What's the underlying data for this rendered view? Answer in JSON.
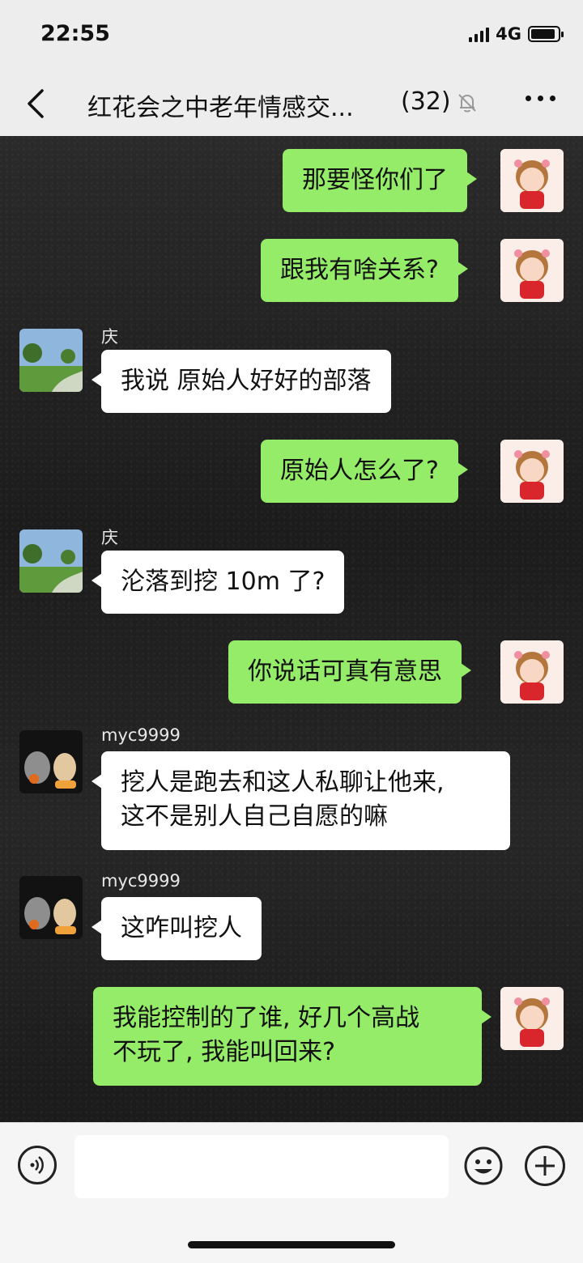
{
  "status_bar": {
    "time": "22:55",
    "network": "4G"
  },
  "header": {
    "title": "红花会之中老年情感交...",
    "member_count": "(32)"
  },
  "messages": [
    {
      "side": "right",
      "text": "那要怪你们了"
    },
    {
      "side": "right",
      "text": "跟我有啥关系?"
    },
    {
      "side": "left",
      "sender": "庆",
      "text": "我说 原始人好好的部落"
    },
    {
      "side": "right",
      "text": "原始人怎么了?"
    },
    {
      "side": "left",
      "sender": "庆",
      "text": "沦落到挖 10m 了?"
    },
    {
      "side": "right",
      "text": "你说话可真有意思"
    },
    {
      "side": "left",
      "sender": "myc9999",
      "line1": "挖人是跑去和这人私聊让他来,",
      "line2": "这不是别人自己自愿的嘛"
    },
    {
      "side": "left",
      "sender": "myc9999",
      "text": "这咋叫挖人"
    },
    {
      "side": "right",
      "line1": "我能控制的了谁, 好几个高战",
      "line2": "不玩了, 我能叫回来?"
    }
  ],
  "colors": {
    "bubble_self": "#95ec69",
    "bubble_other": "#ffffff",
    "header_bg": "#ededed"
  },
  "icons": {
    "back": "chevron-left-icon",
    "mute": "bell-off-icon",
    "more": "more-dots-icon",
    "voice": "voice-icon",
    "emoji": "emoji-icon",
    "add": "plus-icon"
  }
}
